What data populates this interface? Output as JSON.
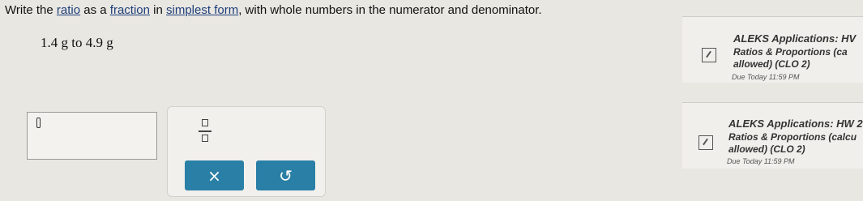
{
  "question": {
    "before": "Write the ",
    "ratio": "ratio",
    "between1": " as a ",
    "fraction": "fraction",
    "between2": " in ",
    "simplest_form": "simplest form",
    "after": ", with whole numbers in the numerator and denominator."
  },
  "problem": {
    "text": "1.4 g to 4.9 g"
  },
  "toolbar": {
    "fraction_icon": "fraction-template-icon",
    "clear_label": "×",
    "undo_label": "↺"
  },
  "assignments": [
    {
      "title": "ALEKS Applications: HV",
      "line1": "Ratios & Proportions (ca",
      "line2": "allowed) (CLO 2)",
      "due": "Due Today 11:59 PM",
      "icon": "assignment-icon"
    },
    {
      "title": "ALEKS Applications: HW 2",
      "line1": "Ratios & Proportions (calcu",
      "line2": "allowed) (CLO 2)",
      "due": "Due Today 11:59 PM",
      "icon": "assignment-icon"
    }
  ]
}
